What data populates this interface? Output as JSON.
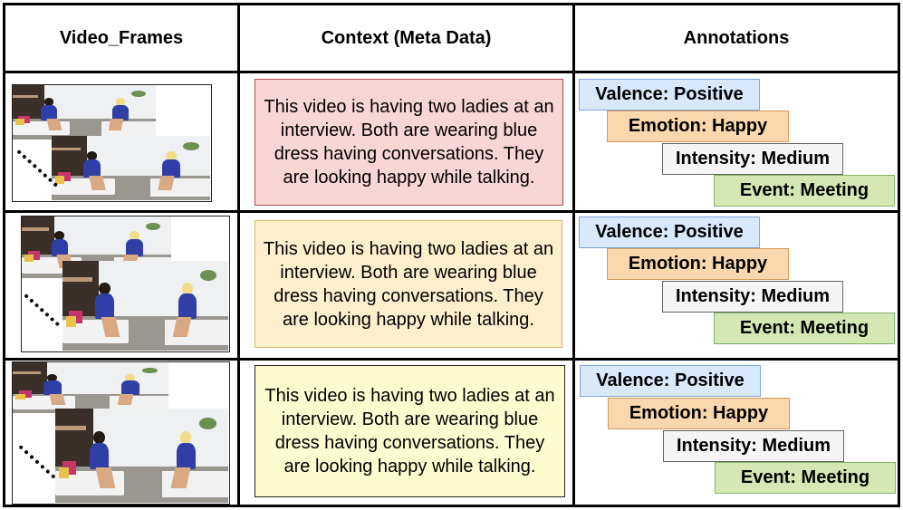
{
  "headers": {
    "frames": "Video_Frames",
    "context": "Context (Meta Data)",
    "annotations": "Annotations"
  },
  "rows": [
    {
      "context": "This video is having two ladies at an interview. Both are wearing blue dress having conversations. They are looking happy while talking.",
      "context_color": "#f8d6d5",
      "annotations": {
        "valence": "Valence: Positive",
        "emotion": "Emotion: Happy",
        "intensity": "Intensity: Medium",
        "event": "Event: Meeting"
      }
    },
    {
      "context": "This video is having two ladies at an interview. Both are wearing blue dress having conversations. They are looking happy while talking.",
      "context_color": "#feefcc",
      "annotations": {
        "valence": "Valence: Positive",
        "emotion": "Emotion: Happy",
        "intensity": "Intensity: Medium",
        "event": "Event: Meeting"
      }
    },
    {
      "context": "This video is having two ladies at an interview. Both are wearing blue dress having conversations. They are looking happy while talking.",
      "context_color": "#fefccf",
      "annotations": {
        "valence": "Valence: Positive",
        "emotion": "Emotion: Happy",
        "intensity": "Intensity: Medium",
        "event": "Event: Meeting"
      }
    }
  ],
  "colors": {
    "valence": "#dae8fc",
    "emotion": "#fad7ac",
    "intensity": "#f5f5f5",
    "event": "#d5e8b4"
  }
}
